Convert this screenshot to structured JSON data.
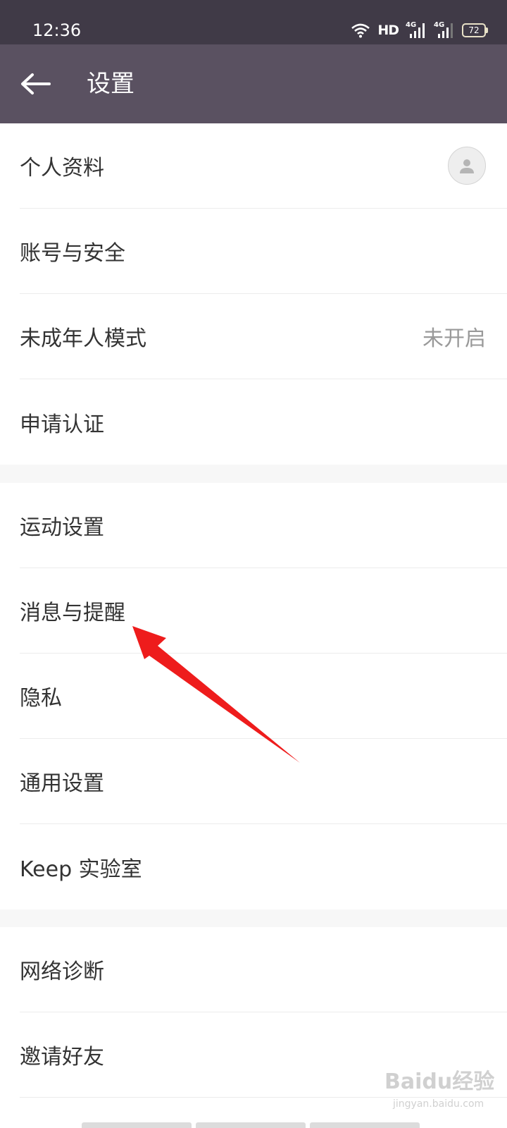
{
  "status_bar": {
    "time": "12:36",
    "hd_label": "HD",
    "network1_label": "4G",
    "network2_label": "4G",
    "battery": "72"
  },
  "header": {
    "title": "设置",
    "back_icon": "arrow-left-icon"
  },
  "sections": [
    {
      "items": [
        {
          "label": "个人资料",
          "trailing": "avatar"
        },
        {
          "label": "账号与安全"
        },
        {
          "label": "未成年人模式",
          "value": "未开启"
        },
        {
          "label": "申请认证"
        }
      ]
    },
    {
      "items": [
        {
          "label": "运动设置"
        },
        {
          "label": "消息与提醒"
        },
        {
          "label": "隐私"
        },
        {
          "label": "通用设置"
        },
        {
          "label": "Keep 实验室"
        }
      ]
    },
    {
      "items": [
        {
          "label": "网络诊断"
        },
        {
          "label": "邀请好友"
        }
      ]
    }
  ],
  "annotation": {
    "color": "#ee1c1c",
    "icon": "red-arrow-annotation"
  },
  "watermark": {
    "main": "Baidu经验",
    "sub": "jingyan.baidu.com"
  },
  "colors": {
    "status_bar_bg": "#403a47",
    "app_bar_bg": "#5a5161",
    "page_bg": "#f7f7f7",
    "row_bg": "#ffffff"
  }
}
